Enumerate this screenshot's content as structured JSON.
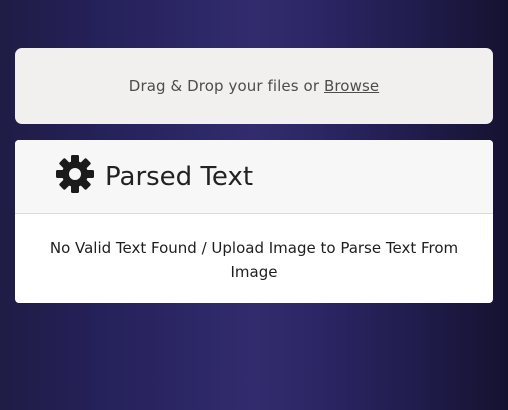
{
  "upload": {
    "prompt": "Drag & Drop your files or ",
    "browse_label": "Browse"
  },
  "parsed_card": {
    "icon": "gear-icon",
    "title": "Parsed Text",
    "message": "No Valid Text Found / Upload Image to Parse Text From Image"
  }
}
